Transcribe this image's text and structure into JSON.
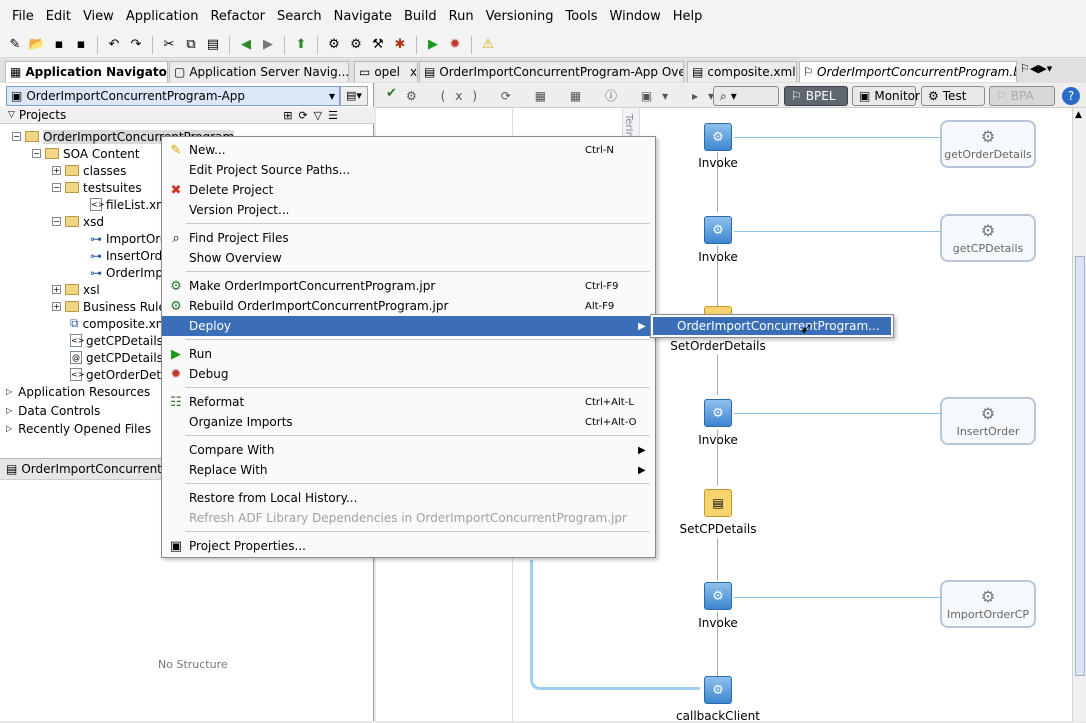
{
  "menubar": [
    "File",
    "Edit",
    "View",
    "Application",
    "Refactor",
    "Search",
    "Navigate",
    "Build",
    "Run",
    "Versioning",
    "Tools",
    "Window",
    "Help"
  ],
  "tabs": {
    "app_navigator": "Application Navigator",
    "app_server": "Application Server Navig...",
    "bpel_partial": "opel",
    "overview": "OrderImportConcurrentProgram-App Overview",
    "composite": "composite.xml",
    "bpel": "OrderImportConcurrentProgram.bpel",
    "close": "x"
  },
  "navigator": {
    "app_selector": "OrderImportConcurrentProgram-App",
    "projects_label": "Projects",
    "tree": [
      {
        "label": "OrderImportConcurrentProgram"
      },
      {
        "label": "SOA Content"
      },
      {
        "label": "classes"
      },
      {
        "label": "testsuites"
      },
      {
        "label": "fileList.xml"
      },
      {
        "label": "xsd"
      },
      {
        "label": "ImportOrde"
      },
      {
        "label": "InsertOrde"
      },
      {
        "label": "OrderImpo"
      },
      {
        "label": "xsl"
      },
      {
        "label": "Business Rules"
      },
      {
        "label": "composite.xml"
      },
      {
        "label": "getCPDetails_f"
      },
      {
        "label": "getCPDetails.w"
      },
      {
        "label": "getOrderDetail"
      }
    ],
    "sections": [
      "Application Resources",
      "Data Controls",
      "Recently Opened Files"
    ]
  },
  "structure": {
    "title": "OrderImportConcurrentProg",
    "empty": "No Structure"
  },
  "editor_toolbar": {
    "bpel": "BPEL",
    "monitor": "Monitor",
    "test": "Test",
    "bpa": "BPA"
  },
  "canvas": {
    "side_label": "TerIm",
    "activities": [
      {
        "label": "Invoke"
      },
      {
        "label": "Invoke"
      },
      {
        "label": "SetOrderDetails"
      },
      {
        "label": "Invoke"
      },
      {
        "label": "SetCPDetails"
      },
      {
        "label": "Invoke"
      },
      {
        "label": "callbackClient"
      }
    ],
    "partners": [
      "getOrderDetails",
      "getCPDetails",
      "InsertOrder",
      "ImportOrderCP"
    ]
  },
  "context_menu": {
    "items": [
      {
        "label": "New...",
        "accel": "Ctrl-N"
      },
      {
        "label": "Edit Project Source Paths...",
        "accel": ""
      },
      {
        "label": "Delete Project",
        "accel": ""
      },
      {
        "label": "Version Project...",
        "accel": ""
      },
      {
        "label": "Find Project Files",
        "accel": ""
      },
      {
        "label": "Show Overview",
        "accel": ""
      },
      {
        "label": "Make OrderImportConcurrentProgram.jpr",
        "accel": "Ctrl-F9"
      },
      {
        "label": "Rebuild OrderImportConcurrentProgram.jpr",
        "accel": "Alt-F9"
      },
      {
        "label": "Deploy",
        "accel": ""
      },
      {
        "label": "Run",
        "accel": ""
      },
      {
        "label": "Debug",
        "accel": ""
      },
      {
        "label": "Reformat",
        "accel": "Ctrl+Alt-L"
      },
      {
        "label": "Organize Imports",
        "accel": "Ctrl+Alt-O"
      },
      {
        "label": "Compare With",
        "accel": ""
      },
      {
        "label": "Replace With",
        "accel": ""
      },
      {
        "label": "Restore from Local History...",
        "accel": ""
      },
      {
        "label": "Refresh ADF Library Dependencies in OrderImportConcurrentProgram.jpr",
        "accel": ""
      },
      {
        "label": "Project Properties...",
        "accel": ""
      }
    ],
    "submenu": "OrderImportConcurrentProgram..."
  },
  "colors": {
    "selection": "#3a6fb8",
    "activity": "#3d86cf",
    "assign": "#f6d36e"
  }
}
